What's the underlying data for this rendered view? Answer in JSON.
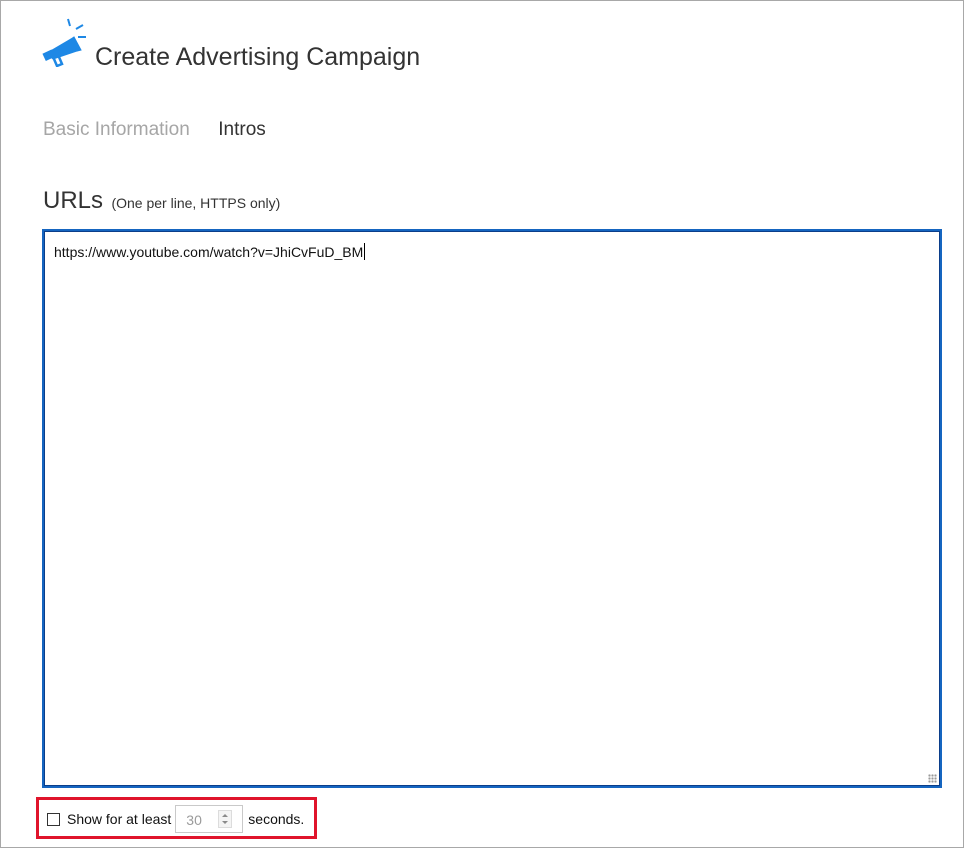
{
  "header": {
    "title": "Create Advertising Campaign",
    "icon": "megaphone-icon",
    "accent_color": "#1e88e5"
  },
  "tabs": [
    {
      "label": "Basic Information",
      "active": false
    },
    {
      "label": "Intros",
      "active": true
    }
  ],
  "urls_section": {
    "label": "URLs",
    "hint": "(One per line, HTTPS only)",
    "value": "https://www.youtube.com/watch?v=JhiCvFuD_BM"
  },
  "show_option": {
    "checked": false,
    "label": "Show for at least",
    "seconds_value": "30",
    "suffix": "seconds."
  },
  "colors": {
    "focus_border": "#1565c0",
    "highlight": "#e0142b",
    "inactive_tab": "#a6a6a6"
  }
}
